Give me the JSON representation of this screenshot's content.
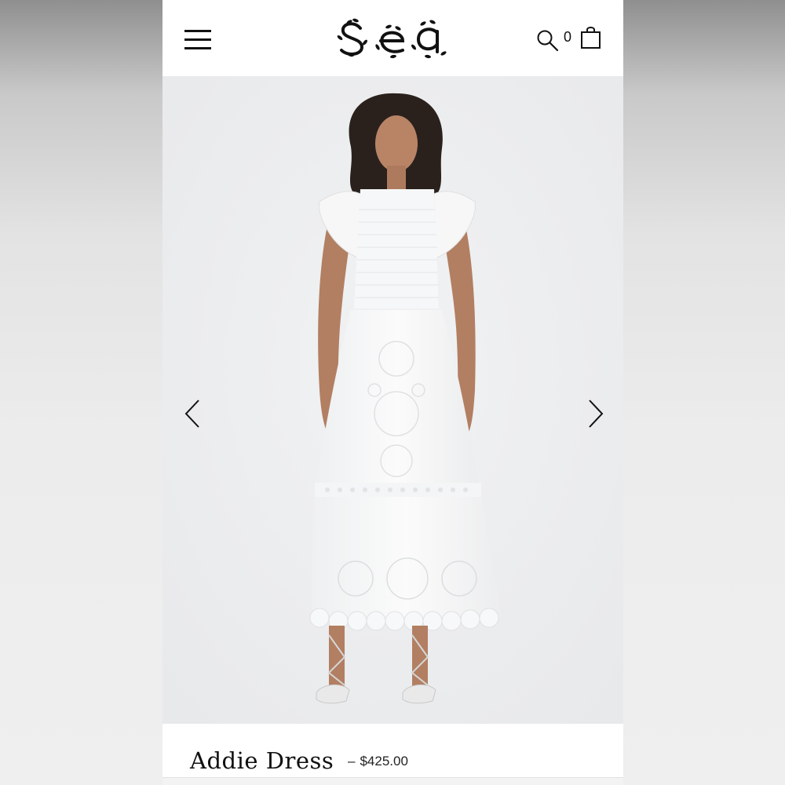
{
  "header": {
    "logo_text": "sea",
    "cart_count": "0",
    "icons": {
      "menu": "hamburger-menu-icon",
      "search": "search-icon",
      "cart": "shopping-bag-icon"
    }
  },
  "gallery": {
    "prev_icon": "chevron-left-icon",
    "next_icon": "chevron-right-icon"
  },
  "product": {
    "name": "Addie Dress",
    "separator": "–",
    "price": "$425.00"
  },
  "colors": {
    "text": "#111111",
    "stage_background": "#ecedef",
    "page_background": "#ffffff"
  }
}
